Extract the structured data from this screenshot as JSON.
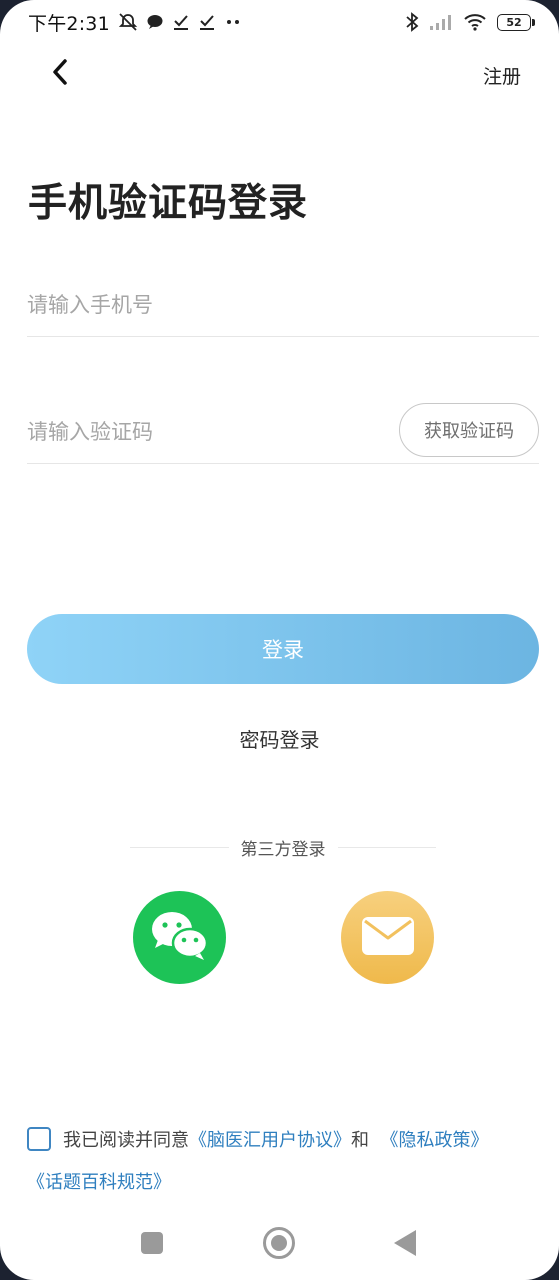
{
  "status_bar": {
    "time": "下午2:31",
    "battery": "52",
    "left_icons": [
      "mute-bell-icon",
      "chat-bubble-icon",
      "download-check-icon",
      "download-check-icon",
      "more-dots-icon"
    ],
    "right_icons": [
      "bluetooth-icon",
      "signal-icon",
      "wifi-icon",
      "battery-icon"
    ]
  },
  "header": {
    "back_icon": "chevron-left-icon",
    "register_label": "注册"
  },
  "page_title": "手机验证码登录",
  "form": {
    "phone_placeholder": "请输入手机号",
    "phone_value": "",
    "code_placeholder": "请输入验证码",
    "code_value": "",
    "get_code_label": "获取验证码"
  },
  "login_button_label": "登录",
  "password_login_label": "密码登录",
  "third_party": {
    "label": "第三方登录",
    "providers": [
      {
        "name": "wechat",
        "icon": "wechat-icon",
        "color": "#1dc357"
      },
      {
        "name": "email",
        "icon": "mail-icon",
        "color": "#f2c15e"
      }
    ]
  },
  "agreement": {
    "checked": false,
    "prefix": "我已阅读并同意",
    "user_agreement": "《脑医汇用户协议》",
    "and": "和",
    "privacy_policy": "《隐私政策》",
    "topic_rules": "《话题百科规范》"
  },
  "colors": {
    "login_gradient_start": "#8fd3f7",
    "login_gradient_end": "#6cb5e2",
    "link": "#2f7fbf"
  }
}
